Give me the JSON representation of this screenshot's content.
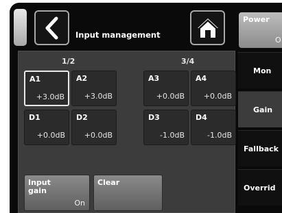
{
  "header": {
    "title": "Input management",
    "back_icon": "chevron-left-icon",
    "home_icon": "home-icon",
    "power": {
      "label": "Power",
      "value": "O"
    }
  },
  "groups": [
    {
      "label": "1/2"
    },
    {
      "label": "3/4"
    }
  ],
  "channels": [
    {
      "name": "A1",
      "gain": "+3.0dB",
      "selected": true
    },
    {
      "name": "A2",
      "gain": "+3.0dB"
    },
    {
      "name": "A3",
      "gain": "+0.0dB"
    },
    {
      "name": "A4",
      "gain": "+0.0dB"
    },
    {
      "name": "D1",
      "gain": "+0.0dB"
    },
    {
      "name": "D2",
      "gain": "+0.0dB"
    },
    {
      "name": "D3",
      "gain": "-1.0dB"
    },
    {
      "name": "D4",
      "gain": "-1.0dB"
    }
  ],
  "buttons": {
    "input_gain": {
      "label": "Input gain",
      "value": "On"
    },
    "clear": {
      "label": "Clear"
    }
  },
  "side_menu": [
    {
      "label": "Mon"
    },
    {
      "label": "Gain",
      "active": true
    },
    {
      "label": "Fallback"
    },
    {
      "label": "Overrid"
    }
  ]
}
